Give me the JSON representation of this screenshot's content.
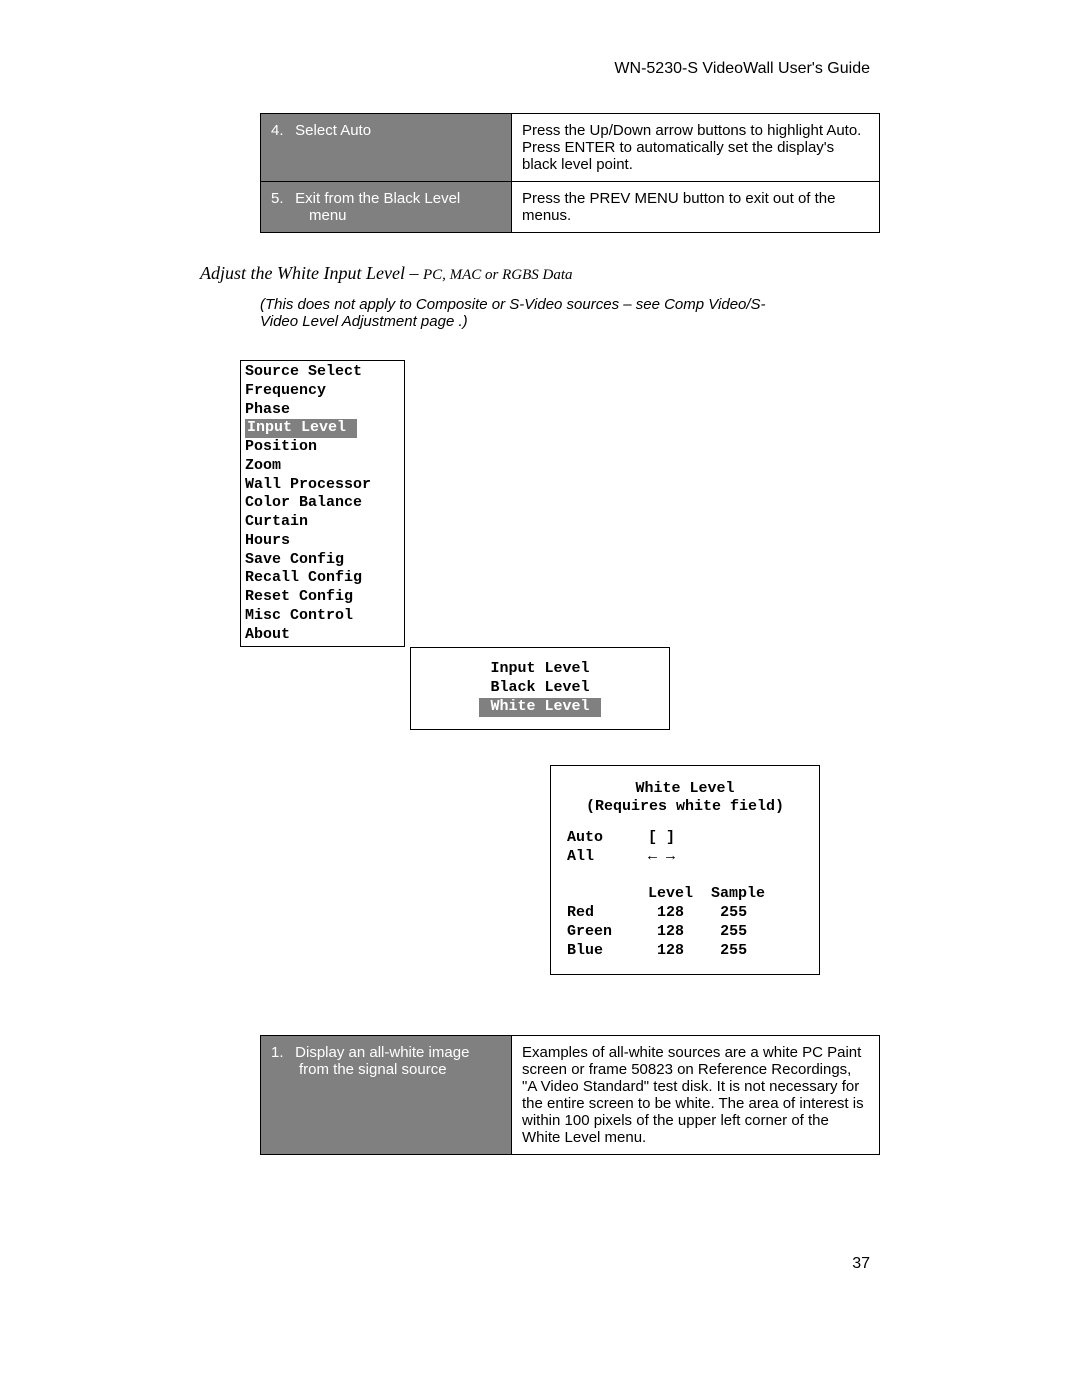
{
  "header": {
    "title": "WN-5230-S VideoWall User's Guide"
  },
  "table1": {
    "rows": [
      {
        "num": "4.",
        "step": "Select Auto",
        "desc": "Press the Up/Down arrow buttons to highlight Auto. Press ENTER to automatically set the display's black level point."
      },
      {
        "num": "5.",
        "step_line1": "Exit from the Black Level",
        "step_line2": "menu",
        "desc": "Press the PREV MENU button to exit out of the menus."
      }
    ]
  },
  "section": {
    "heading_main": "Adjust the White Input Level – ",
    "heading_sub": "PC, MAC or RGBS Data",
    "note": "(This does not apply to Composite or S-Video sources – see Comp Video/S-Video Level Adjustment page .)"
  },
  "main_menu": {
    "items": [
      "Source Select",
      "Frequency",
      "Phase",
      "Input Level",
      "Position",
      "Zoom",
      "Wall Processor",
      "Color Balance",
      "Curtain",
      "Hours",
      "Save Config",
      "Recall Config",
      "Reset Config",
      "Misc Control",
      "About"
    ],
    "highlighted_index": 3
  },
  "sub_menu": {
    "items": [
      "Input Level",
      "Black Level",
      "White Level"
    ],
    "highlighted_index": 2
  },
  "detail_menu": {
    "title": "White Level",
    "subtitle": "(Requires white field)",
    "auto_label": "Auto",
    "auto_value": "[ ]",
    "all_label": "All",
    "all_value": "← →",
    "col_level": "Level",
    "col_sample": "Sample",
    "rows": [
      {
        "name": "Red",
        "level": "128",
        "sample": "255"
      },
      {
        "name": "Green",
        "level": "128",
        "sample": "255"
      },
      {
        "name": "Blue",
        "level": "128",
        "sample": "255"
      }
    ]
  },
  "table2": {
    "rows": [
      {
        "num": "1.",
        "step_line1": "Display an all-white image",
        "step_line2": "from   the signal source",
        "desc": "Examples of all-white sources are a white PC Paint screen or frame 50823 on Reference Recordings, \"A Video Standard\" test disk. It is not necessary for the entire screen to be white. The area of interest is within 100 pixels of the upper left corner of the White Level menu."
      }
    ]
  },
  "page_number": "37"
}
